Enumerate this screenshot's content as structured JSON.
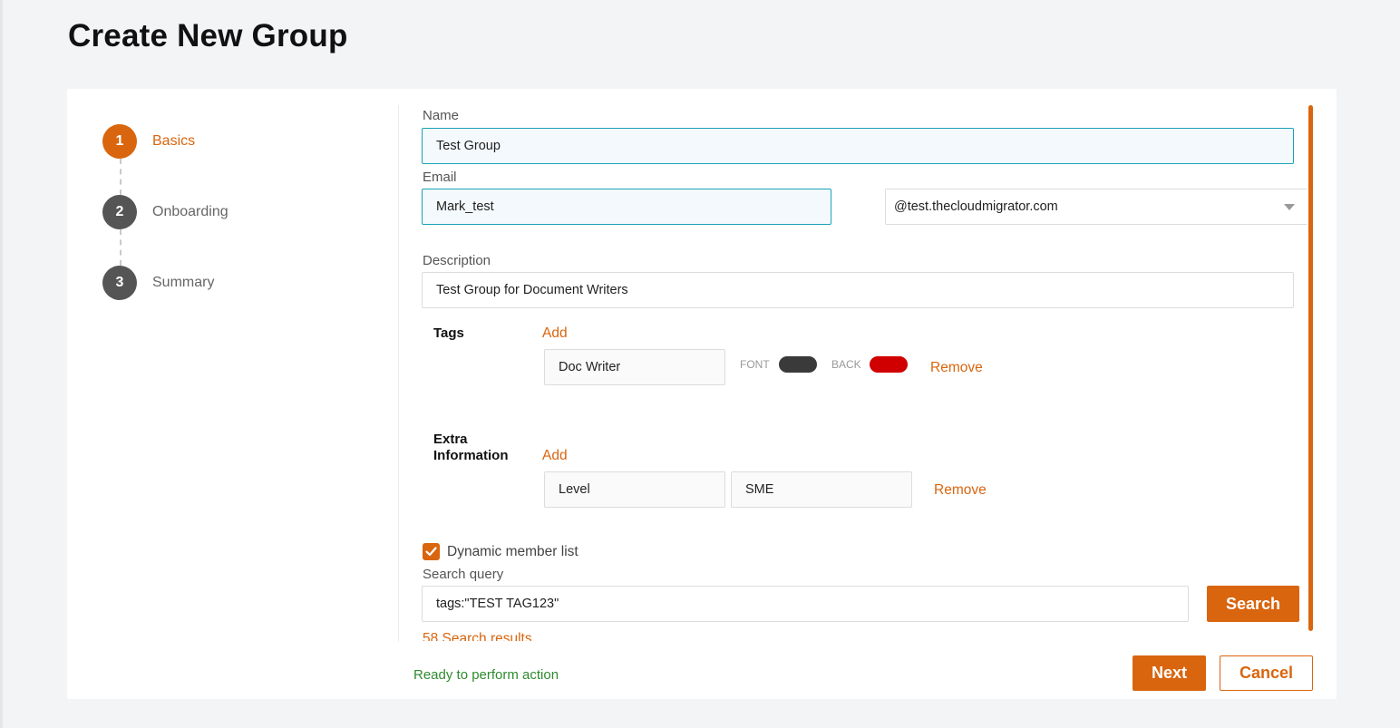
{
  "page": {
    "title": "Create New Group"
  },
  "stepper": {
    "steps": [
      {
        "number": "1",
        "label": "Basics"
      },
      {
        "number": "2",
        "label": "Onboarding"
      },
      {
        "number": "3",
        "label": "Summary"
      }
    ],
    "active_step": 1
  },
  "form": {
    "name": {
      "label": "Name",
      "value": "Test Group"
    },
    "email": {
      "label": "Email",
      "value": "Mark_test",
      "domain": "@test.thecloudmigrator.com"
    },
    "description": {
      "label": "Description",
      "value": "Test Group for Document Writers"
    },
    "tags": {
      "label": "Tags",
      "add_label": "Add",
      "items": [
        {
          "value": "Doc Writer",
          "font_label": "FONT",
          "font_color": "#3a3a3a",
          "back_label": "BACK",
          "back_color": "#d10000",
          "remove_label": "Remove"
        }
      ]
    },
    "extra_information": {
      "label_line1": "Extra",
      "label_line2": "Information",
      "add_label": "Add",
      "items": [
        {
          "key": "Level",
          "value": "SME",
          "remove_label": "Remove"
        }
      ]
    },
    "dynamic_member_list": {
      "label": "Dynamic member list",
      "checked": true
    },
    "search_query": {
      "label": "Search query",
      "value": "tags:\"TEST TAG123\"",
      "button_label": "Search"
    },
    "search_results": {
      "text": "58 Search results"
    }
  },
  "footer": {
    "status": "Ready to perform action",
    "next_label": "Next",
    "cancel_label": "Cancel"
  },
  "colors": {
    "accent": "#d9650e",
    "focus_border": "#1aa3b8",
    "status_green": "#2e8b2e",
    "step_inactive": "#555555"
  }
}
